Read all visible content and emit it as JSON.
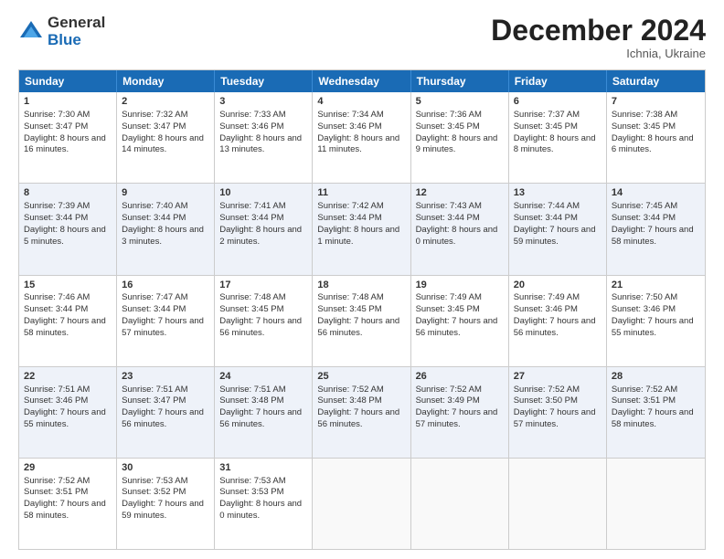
{
  "logo": {
    "general": "General",
    "blue": "Blue"
  },
  "header": {
    "month": "December 2024",
    "location": "Ichnia, Ukraine"
  },
  "days": [
    "Sunday",
    "Monday",
    "Tuesday",
    "Wednesday",
    "Thursday",
    "Friday",
    "Saturday"
  ],
  "rows": [
    [
      {
        "num": "1",
        "rise": "7:30 AM",
        "set": "3:47 PM",
        "daylight": "8 hours and 16 minutes."
      },
      {
        "num": "2",
        "rise": "7:32 AM",
        "set": "3:47 PM",
        "daylight": "8 hours and 14 minutes."
      },
      {
        "num": "3",
        "rise": "7:33 AM",
        "set": "3:46 PM",
        "daylight": "8 hours and 13 minutes."
      },
      {
        "num": "4",
        "rise": "7:34 AM",
        "set": "3:46 PM",
        "daylight": "8 hours and 11 minutes."
      },
      {
        "num": "5",
        "rise": "7:36 AM",
        "set": "3:45 PM",
        "daylight": "8 hours and 9 minutes."
      },
      {
        "num": "6",
        "rise": "7:37 AM",
        "set": "3:45 PM",
        "daylight": "8 hours and 8 minutes."
      },
      {
        "num": "7",
        "rise": "7:38 AM",
        "set": "3:45 PM",
        "daylight": "8 hours and 6 minutes."
      }
    ],
    [
      {
        "num": "8",
        "rise": "7:39 AM",
        "set": "3:44 PM",
        "daylight": "8 hours and 5 minutes."
      },
      {
        "num": "9",
        "rise": "7:40 AM",
        "set": "3:44 PM",
        "daylight": "8 hours and 3 minutes."
      },
      {
        "num": "10",
        "rise": "7:41 AM",
        "set": "3:44 PM",
        "daylight": "8 hours and 2 minutes."
      },
      {
        "num": "11",
        "rise": "7:42 AM",
        "set": "3:44 PM",
        "daylight": "8 hours and 1 minute."
      },
      {
        "num": "12",
        "rise": "7:43 AM",
        "set": "3:44 PM",
        "daylight": "8 hours and 0 minutes."
      },
      {
        "num": "13",
        "rise": "7:44 AM",
        "set": "3:44 PM",
        "daylight": "7 hours and 59 minutes."
      },
      {
        "num": "14",
        "rise": "7:45 AM",
        "set": "3:44 PM",
        "daylight": "7 hours and 58 minutes."
      }
    ],
    [
      {
        "num": "15",
        "rise": "7:46 AM",
        "set": "3:44 PM",
        "daylight": "7 hours and 58 minutes."
      },
      {
        "num": "16",
        "rise": "7:47 AM",
        "set": "3:44 PM",
        "daylight": "7 hours and 57 minutes."
      },
      {
        "num": "17",
        "rise": "7:48 AM",
        "set": "3:45 PM",
        "daylight": "7 hours and 56 minutes."
      },
      {
        "num": "18",
        "rise": "7:48 AM",
        "set": "3:45 PM",
        "daylight": "7 hours and 56 minutes."
      },
      {
        "num": "19",
        "rise": "7:49 AM",
        "set": "3:45 PM",
        "daylight": "7 hours and 56 minutes."
      },
      {
        "num": "20",
        "rise": "7:49 AM",
        "set": "3:46 PM",
        "daylight": "7 hours and 56 minutes."
      },
      {
        "num": "21",
        "rise": "7:50 AM",
        "set": "3:46 PM",
        "daylight": "7 hours and 55 minutes."
      }
    ],
    [
      {
        "num": "22",
        "rise": "7:51 AM",
        "set": "3:46 PM",
        "daylight": "7 hours and 55 minutes."
      },
      {
        "num": "23",
        "rise": "7:51 AM",
        "set": "3:47 PM",
        "daylight": "7 hours and 56 minutes."
      },
      {
        "num": "24",
        "rise": "7:51 AM",
        "set": "3:48 PM",
        "daylight": "7 hours and 56 minutes."
      },
      {
        "num": "25",
        "rise": "7:52 AM",
        "set": "3:48 PM",
        "daylight": "7 hours and 56 minutes."
      },
      {
        "num": "26",
        "rise": "7:52 AM",
        "set": "3:49 PM",
        "daylight": "7 hours and 57 minutes."
      },
      {
        "num": "27",
        "rise": "7:52 AM",
        "set": "3:50 PM",
        "daylight": "7 hours and 57 minutes."
      },
      {
        "num": "28",
        "rise": "7:52 AM",
        "set": "3:51 PM",
        "daylight": "7 hours and 58 minutes."
      }
    ],
    [
      {
        "num": "29",
        "rise": "7:52 AM",
        "set": "3:51 PM",
        "daylight": "7 hours and 58 minutes."
      },
      {
        "num": "30",
        "rise": "7:53 AM",
        "set": "3:52 PM",
        "daylight": "7 hours and 59 minutes."
      },
      {
        "num": "31",
        "rise": "7:53 AM",
        "set": "3:53 PM",
        "daylight": "8 hours and 0 minutes."
      },
      null,
      null,
      null,
      null
    ]
  ],
  "labels": {
    "sunrise": "Sunrise:",
    "sunset": "Sunset:",
    "daylight": "Daylight:"
  }
}
